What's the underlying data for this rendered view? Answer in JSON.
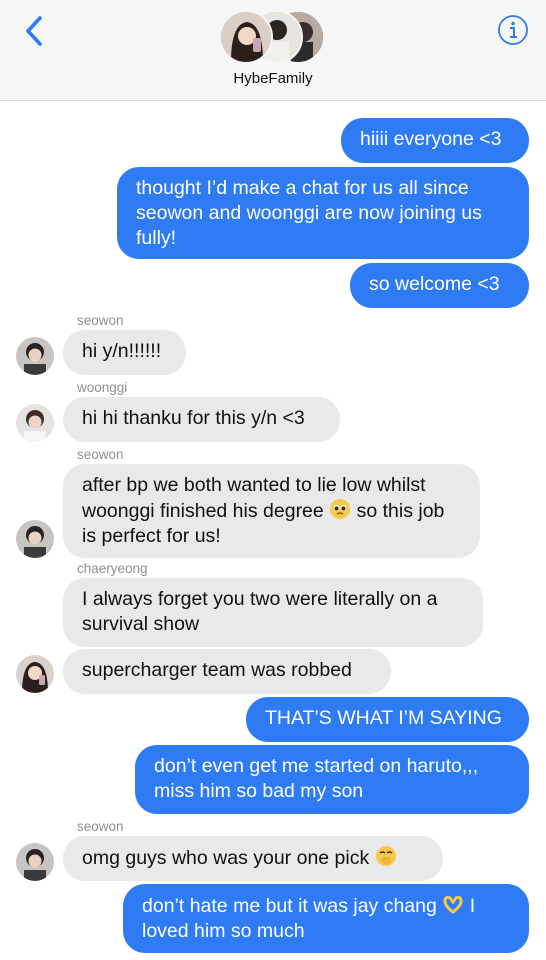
{
  "header": {
    "group_name": "HybeFamily",
    "back_icon": "chevron-left-icon",
    "info_icon": "info-circle-icon",
    "accent_color": "#2e7bf4"
  },
  "messages": [
    {
      "from": "me",
      "text": "hiiii everyone <3"
    },
    {
      "from": "me",
      "text": "thought I’d make a chat for us all since seowon and woonggi are now joining us fully!"
    },
    {
      "from": "me",
      "text": "so welcome <3"
    },
    {
      "from": "seowon",
      "sender_label": "seowon",
      "text": "hi y/n!!!!!!"
    },
    {
      "from": "woonggi",
      "sender_label": "woonggi",
      "text": "hi hi thanku for this y/n <3"
    },
    {
      "from": "seowon",
      "sender_label": "seowon",
      "text_a": "after bp we both wanted to lie low whilst woonggi finished his degree",
      "emoji": "pleading-face-emoji",
      "text_b": "so this job is perfect for us!"
    },
    {
      "from": "chaeryeong",
      "sender_label": "chaeryeong",
      "text": "I always forget you two were literally on a survival show"
    },
    {
      "from": "chaeryeong",
      "text": "supercharger team was robbed"
    },
    {
      "from": "me",
      "text": "THAT’S WHAT I’M SAYING"
    },
    {
      "from": "me",
      "text": "don’t even get me started on haruto,,, miss him so bad my son"
    },
    {
      "from": "seowon",
      "sender_label": "seowon",
      "text": "omg guys who was your one pick",
      "emoji": "hand-over-mouth-emoji"
    },
    {
      "from": "me",
      "text_a": "don’t hate me but it was jay chang",
      "emoji": "heart-hands-emoji",
      "text_b": "I loved him so much"
    }
  ],
  "colors": {
    "outgoing_bubble": "#2e7bf4",
    "incoming_bubble": "#e9e9eb",
    "sender_label": "#8e8e93"
  }
}
